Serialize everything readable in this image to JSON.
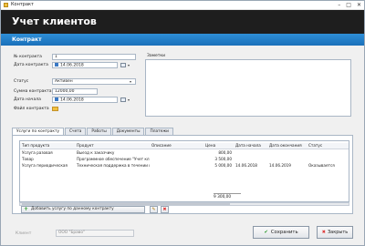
{
  "window": {
    "title": "Контракт",
    "controls": [
      "–",
      "□",
      "✕"
    ]
  },
  "header": {
    "title": "Учет клиентов",
    "subtitle": "Контракт"
  },
  "form": {
    "contract_no_label": "№ контракта",
    "contract_no": "1",
    "contract_date_label": "Дата контракта",
    "contract_date": "14.06.2018",
    "status_label": "Статус",
    "status": "Активен",
    "sum_label": "Сумма контракта",
    "sum": "12000,00",
    "start_date_label": "Дата начала",
    "start_date": "14.06.2018",
    "file_label": "Файл контракта",
    "notes_label": "Заметки"
  },
  "tabs": [
    "Услуги по контракту",
    "Счета",
    "Работы",
    "Документы",
    "Платежи"
  ],
  "active_tab": 0,
  "table": {
    "columns": [
      "Тип продукта",
      "Продукт",
      "Описание",
      "Цена",
      "Дата начала",
      "Дата окончания",
      "Статус"
    ],
    "rows": [
      [
        "Услуга разовая",
        "Выезд к заказчику",
        "",
        "800,00",
        "",
        "",
        ""
      ],
      [
        "Товар",
        "Программное обеспечение \"Учет клиентов\"",
        "",
        "3 500,00",
        "",
        "",
        ""
      ],
      [
        "Услуга периодическая",
        "Техническая поддержка в течении года",
        "",
        "5 000,00",
        "14.06.2018",
        "14.06.2019",
        "Оказывается"
      ]
    ],
    "total": "9 300,00"
  },
  "buttons": {
    "add_service": "Добавить услугу по данному контракту",
    "edit": "✎",
    "delete": "✖",
    "save": "Сохранить",
    "close": "Закрыть"
  },
  "client": {
    "label": "Клиент",
    "value": "ООО \"Браво\""
  },
  "colors": {
    "header_bg": "#1e1e1e",
    "accent": "#1f7ac8"
  }
}
